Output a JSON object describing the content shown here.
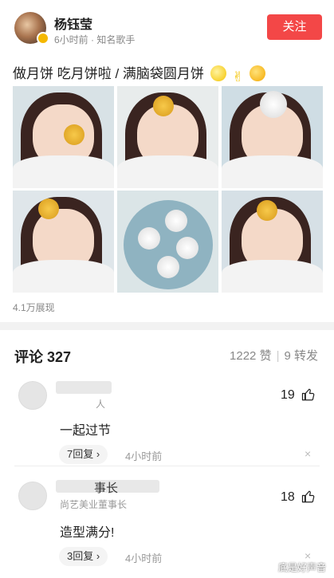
{
  "post": {
    "author": "杨钰莹",
    "meta": "6小时前 · 知名歌手",
    "follow_label": "关注",
    "text": "做月饼 吃月饼啦 / 满脑袋圆月饼",
    "emojis": [
      "moon-emoji",
      "victory-hand-emoji",
      "kiss-face-emoji"
    ],
    "views": "4.1万展现"
  },
  "comments_header": {
    "title": "评论 327",
    "likes": "1222 赞",
    "reposts": "9 转发"
  },
  "comments": [
    {
      "sub": "人",
      "text": "一起过节",
      "replies": "7回复 ›",
      "time": "4小时前",
      "likes": "19",
      "close": "×"
    },
    {
      "name": "事长",
      "sub": "尚艺美业董事长",
      "text": "造型满分!",
      "replies": "3回复 ›",
      "time": "4小时前",
      "likes": "18",
      "close": "×"
    }
  ],
  "watermark": "底是好声音",
  "colors": {
    "accent": "#f34747",
    "muted": "#888888"
  }
}
